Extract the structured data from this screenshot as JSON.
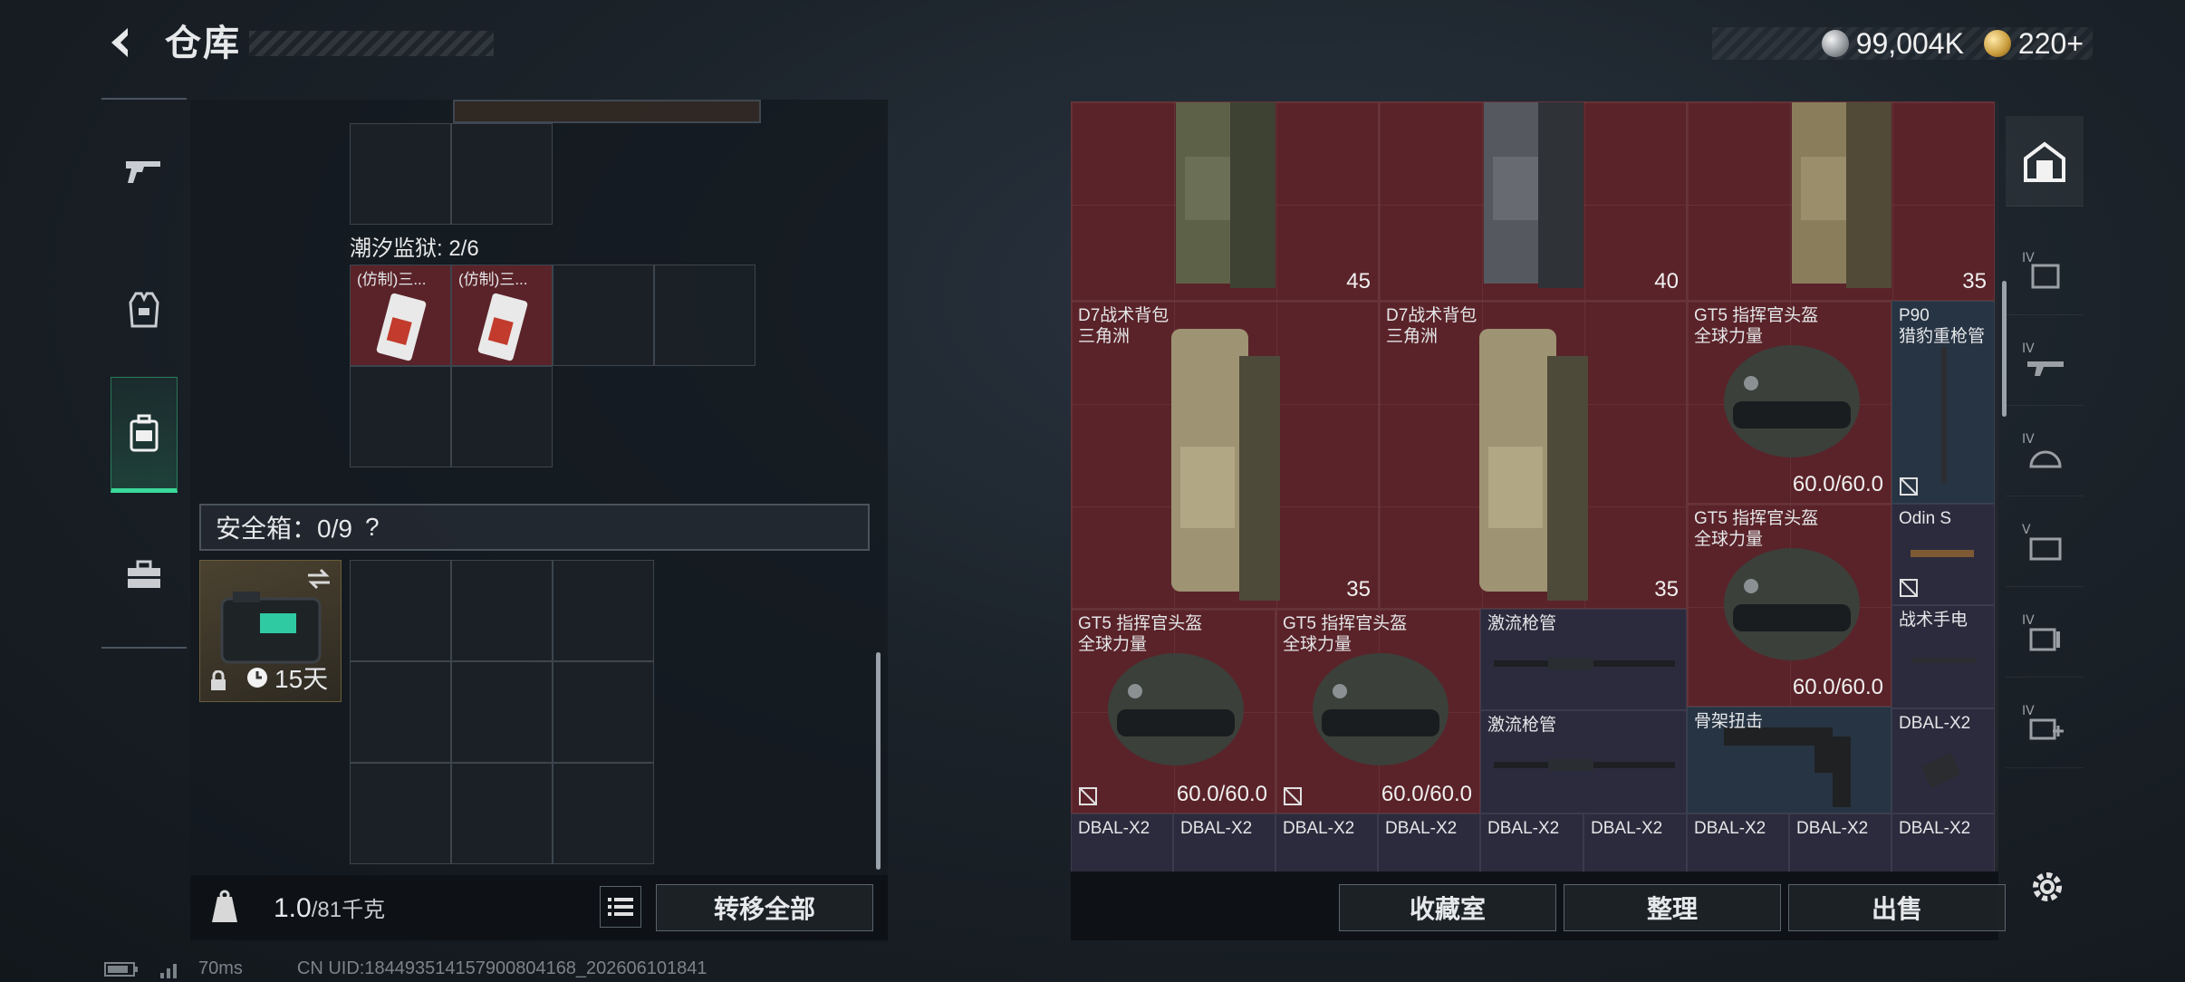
{
  "header": {
    "title": "仓库",
    "currency": [
      {
        "icon": "silver-coin-icon",
        "value": "99,004K"
      },
      {
        "icon": "gold-coin-icon",
        "value": "220+"
      }
    ]
  },
  "left_nav": [
    "gun-icon",
    "vest-icon",
    "backpack-icon",
    "toolbox-icon"
  ],
  "left_panel": {
    "container_label": "潮汐监狱: 2/6",
    "items": [
      {
        "name": "(仿制)三..."
      },
      {
        "name": "(仿制)三..."
      }
    ],
    "safe_box_label": "安全箱：0/9",
    "safe_box_help": "?",
    "safe_item_time": "15天",
    "weight_value": "1.0",
    "weight_max": "/81千克",
    "transfer_all": "转移全部"
  },
  "right_panel": {
    "items": [
      {
        "name": "",
        "value": "45"
      },
      {
        "name": "",
        "value": "40"
      },
      {
        "name": "",
        "value": "35"
      },
      {
        "name": "D7战术背包\n三角洲",
        "value": "35"
      },
      {
        "name": "D7战术背包\n三角洲",
        "value": "35"
      },
      {
        "name": "GT5 指挥官头盔\n全球力量",
        "value": "60.0/60.0"
      },
      {
        "name": "P90\n猎豹重枪管",
        "value": ""
      },
      {
        "name": "GT5 指挥官头盔\n全球力量",
        "value": "60.0/60.0"
      },
      {
        "name": "Odin S",
        "value": ""
      },
      {
        "name": "GT5 指挥官头盔\n全球力量",
        "value": "60.0/60.0"
      },
      {
        "name": "GT5 指挥官头盔\n全球力量",
        "value": "60.0/60.0"
      },
      {
        "name": "激流枪管",
        "value": ""
      },
      {
        "name": "战术手电",
        "value": ""
      },
      {
        "name": "激流枪管",
        "value": ""
      },
      {
        "name": "骨架扭击",
        "value": ""
      },
      {
        "name": "DBAL-X2",
        "value": ""
      },
      {
        "name": "DBAL-X2",
        "value": ""
      },
      {
        "name": "DBAL-X2",
        "value": ""
      },
      {
        "name": "DBAL-X2",
        "value": ""
      },
      {
        "name": "DBAL-X2",
        "value": ""
      },
      {
        "name": "DBAL-X2",
        "value": ""
      },
      {
        "name": "DBAL-X2",
        "value": ""
      },
      {
        "name": "DBAL-X2",
        "value": ""
      },
      {
        "name": "DBAL-X2",
        "value": ""
      },
      {
        "name": "DBAL-X2",
        "value": ""
      }
    ],
    "buttons": {
      "collection": "收藏室",
      "organize": "整理",
      "sell": "出售"
    }
  },
  "right_nav": [
    "stash-icon",
    "tier-iv-armor-icon",
    "tier-iv-rifle-icon",
    "tier-iv-helmet-icon",
    "tier-v-case-icon",
    "tier-iv-ammo-icon",
    "tier-iv-medkit-icon"
  ],
  "footer": {
    "ping": "70ms",
    "uid": "CN UID:18449351415790080416​8_202606101841"
  },
  "colors": {
    "accent": "#3bd99a",
    "rare_red": "#5a2329",
    "epic_purple": "#2c2b3d",
    "blue": "#273443"
  }
}
